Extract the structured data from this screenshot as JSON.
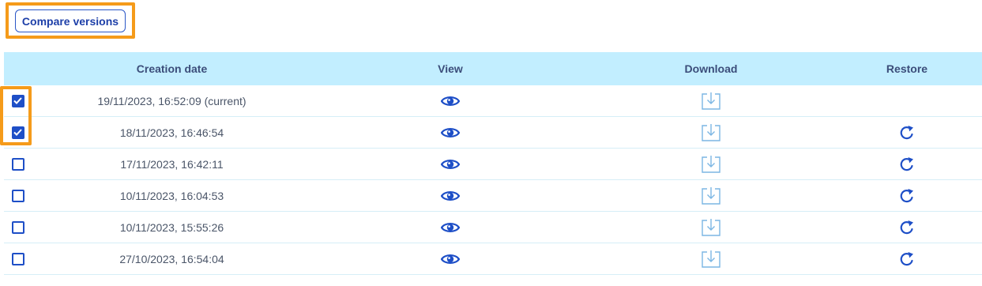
{
  "toolbar": {
    "compare_label": "Compare versions"
  },
  "table": {
    "headers": {
      "date": "Creation date",
      "view": "View",
      "download": "Download",
      "restore": "Restore"
    },
    "rows": [
      {
        "date": "19/11/2023, 16:52:09 (current)",
        "checked": true,
        "restore": false
      },
      {
        "date": "18/11/2023, 16:46:54",
        "checked": true,
        "restore": true
      },
      {
        "date": "17/11/2023, 16:42:11",
        "checked": false,
        "restore": true
      },
      {
        "date": "10/11/2023, 16:04:53",
        "checked": false,
        "restore": true
      },
      {
        "date": "10/11/2023, 15:55:26",
        "checked": false,
        "restore": true
      },
      {
        "date": "27/10/2023, 16:54:04",
        "checked": false,
        "restore": true
      }
    ]
  },
  "icons": {
    "view": "eye-icon",
    "download": "download-icon",
    "restore": "restore-icon",
    "check": "checkmark-icon"
  },
  "colors": {
    "accent": "#1e4fc7",
    "header_bg": "#c2eeff",
    "highlight": "#f59b1a",
    "download_icon": "#7bb6e3"
  }
}
